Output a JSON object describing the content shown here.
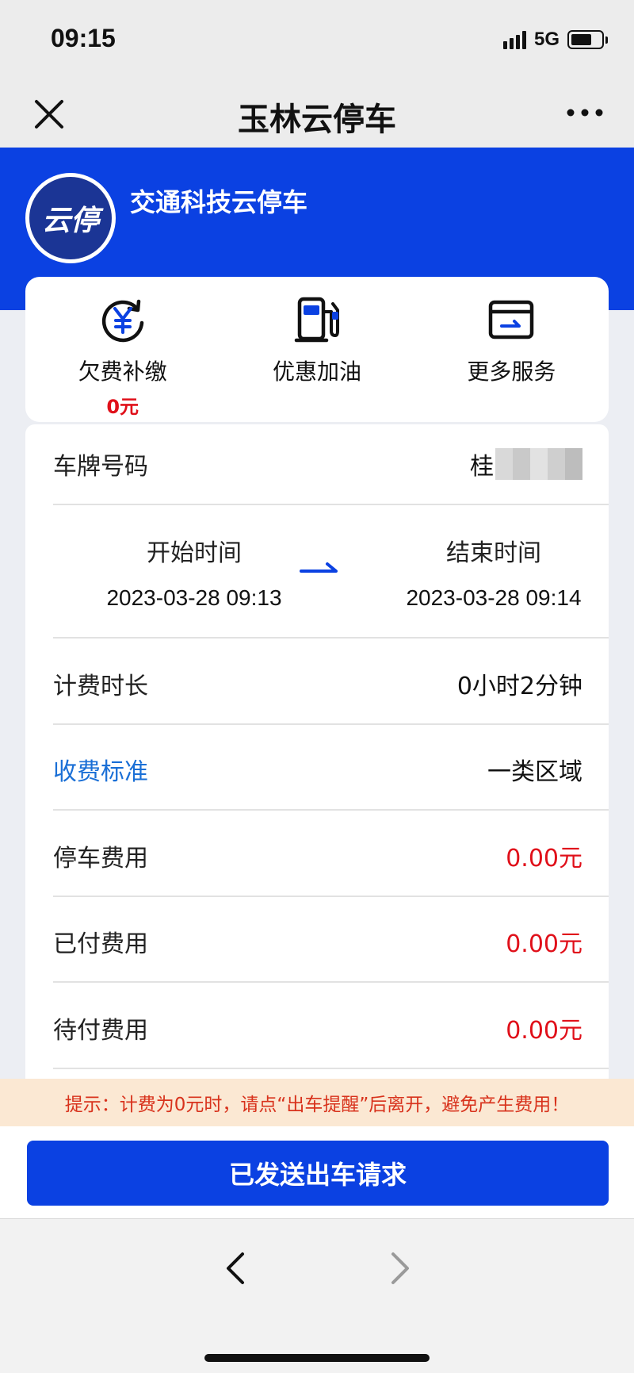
{
  "status": {
    "time": "09:15",
    "network": "5G",
    "battery_level": 0.7
  },
  "nav": {
    "title": "玉林云停车"
  },
  "header": {
    "logo_text": "云停",
    "company": "交通科技云停车"
  },
  "services": [
    {
      "label": "欠费补缴",
      "sub": "0元",
      "icon": "yen-refresh-icon"
    },
    {
      "label": "优惠加油",
      "sub": "",
      "icon": "fuel-pump-icon"
    },
    {
      "label": "更多服务",
      "sub": "",
      "icon": "card-arrow-icon"
    }
  ],
  "detail": {
    "plate_label": "车牌号码",
    "plate_prefix": "桂",
    "start_label": "开始时间",
    "start_time": "2023-03-28 09:13",
    "end_label": "结束时间",
    "end_time": "2023-03-28 09:14",
    "duration_label": "计费时长",
    "duration_value": "0小时2分钟",
    "standard_label": "收费标准",
    "standard_value": "一类区域",
    "parking_fee_label": "停车费用",
    "parking_fee_value": "0.00元",
    "paid_label": "已付费用",
    "paid_value": "0.00元",
    "pending_label": "待付费用",
    "pending_value": "0.00元"
  },
  "tip": "提示：计费为0元时，请点“出车提醒”后离开，避免产生费用！",
  "action": {
    "button_label": "已发送出车请求"
  },
  "colors": {
    "brand_blue": "#0b41e2",
    "fee_red": "#e0101a",
    "link_blue": "#1a6fd6",
    "tip_bg": "#fbe8d3"
  }
}
